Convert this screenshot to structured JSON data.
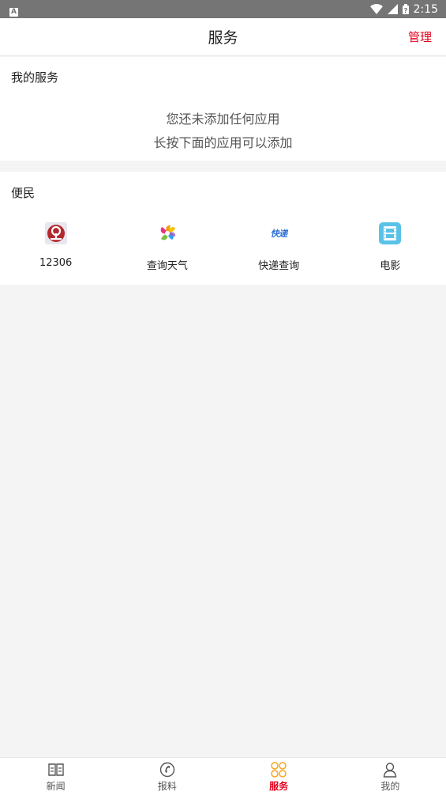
{
  "status_bar": {
    "time": "2:15",
    "left_badge": "A"
  },
  "header": {
    "title": "服务",
    "manage_label": "管理"
  },
  "my_services": {
    "title": "我的服务",
    "empty_line1": "您还未添加任何应用",
    "empty_line2": "长按下面的应用可以添加"
  },
  "convenient": {
    "title": "便民",
    "apps": [
      {
        "label": "12306",
        "icon": "railway-logo-icon"
      },
      {
        "label": "查询天气",
        "icon": "weather-pinwheel-icon"
      },
      {
        "label": "快递查询",
        "icon": "express-logo-icon",
        "icon_text": "快递"
      },
      {
        "label": "电影",
        "icon": "film-icon"
      }
    ]
  },
  "tabs": [
    {
      "label": "新闻",
      "icon": "book-icon",
      "active": false
    },
    {
      "label": "报料",
      "icon": "phone-circle-icon",
      "active": false
    },
    {
      "label": "服务",
      "icon": "grid-circles-icon",
      "active": true
    },
    {
      "label": "我的",
      "icon": "person-icon",
      "active": false
    }
  ],
  "colors": {
    "accent": "#e3001b",
    "active_icon": "#f5a623",
    "status_bar": "#757575"
  }
}
